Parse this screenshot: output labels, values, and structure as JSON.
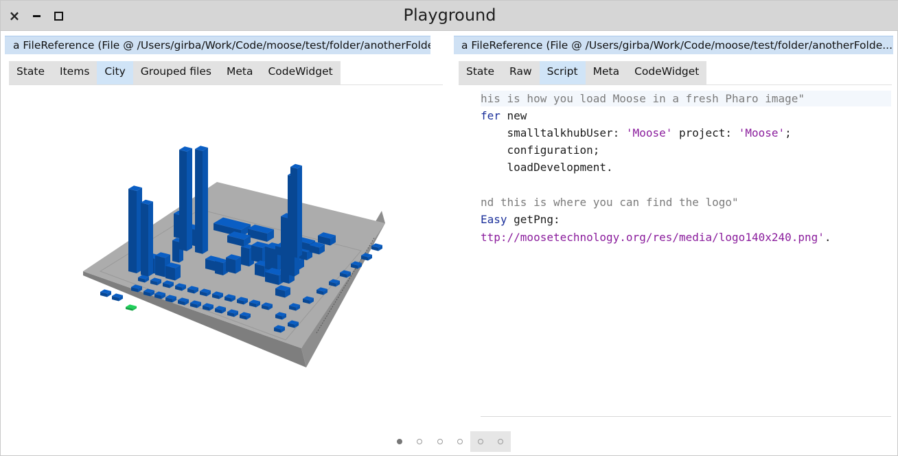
{
  "window": {
    "title": "Playground"
  },
  "left_pane": {
    "header": "a FileReference (File @ /Users/girba/Work/Code/moose/test/folder/anotherFolder)",
    "tabs": [
      "State",
      "Items",
      "City",
      "Grouped files",
      "Meta",
      "CodeWidget"
    ],
    "active_tab": "City"
  },
  "right_pane": {
    "header": "a FileReference (File @ /Users/girba/Work/Code/moose/test/folder/anotherFolde...",
    "tabs": [
      "State",
      "Raw",
      "Script",
      "Meta",
      "CodeWidget"
    ],
    "active_tab": "Script",
    "code": {
      "line1": "his is how you load Moose in a fresh Pharo image\"",
      "line2_var": "fer",
      "line2_rest": " new",
      "line3_pre": "    smalltalkhubUser: ",
      "line3_str1": "'Moose'",
      "line3_mid": " project: ",
      "line3_str2": "'Moose'",
      "line3_end": ";",
      "line4": "    configuration;",
      "line5": "    loadDevelopment.",
      "line7": "nd this is where you can find the logo\"",
      "line8_var": "Easy",
      "line8_rest": " getPng:",
      "line9_str": "ttp://moosetechnology.org/res/media/logo140x240.png'",
      "line9_end": "."
    }
  },
  "pager": {
    "count": 6,
    "current": 1
  },
  "colors": {
    "building": "#0a5ec4",
    "highlight": "#1fd15a",
    "platform": "#aaaaaa",
    "tab_active": "#d0e4f7",
    "header": "#cfe1f4"
  }
}
